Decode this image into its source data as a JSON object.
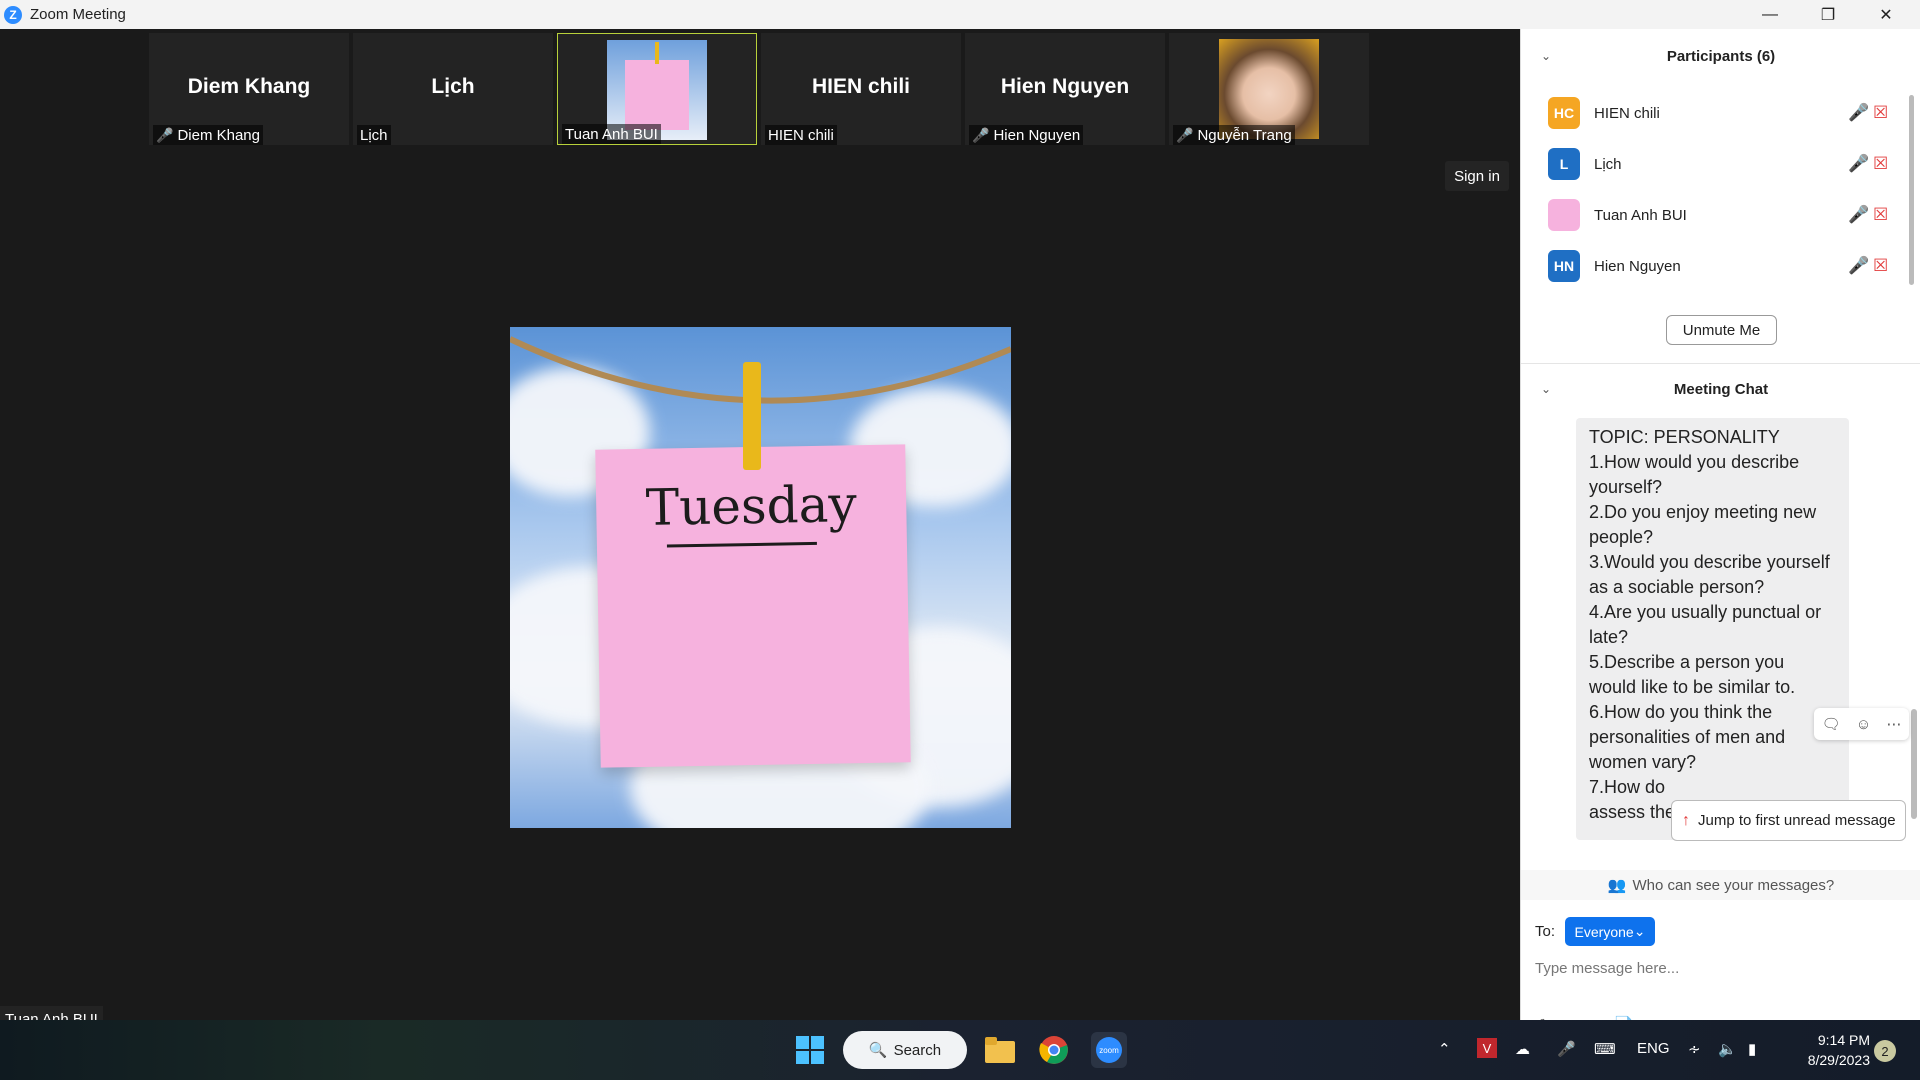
{
  "window": {
    "title": "Zoom Meeting"
  },
  "thumbnails": [
    {
      "name": "Diem Khang",
      "label": "Diem Khang",
      "muted": true
    },
    {
      "name": "Lịch",
      "label": "Lịch",
      "muted": false
    },
    {
      "name": "",
      "label": "Tuan Anh BUI",
      "muted": false
    },
    {
      "name": "HIEN chili",
      "label": "HIEN chili",
      "muted": false
    },
    {
      "name": "Hien Nguyen",
      "label": "Hien Nguyen",
      "muted": true
    },
    {
      "name": "",
      "label": "Nguyễn Trang",
      "muted": true
    }
  ],
  "sign_in": "Sign in",
  "shared_image_text": "Tuesday",
  "active_speaker": "Tuan Anh BUI",
  "participants": {
    "title": "Participants (6)",
    "list": [
      {
        "initials": "HC",
        "name": "HIEN chili",
        "color": "#f5a623",
        "mic_muted": false
      },
      {
        "initials": "L",
        "name": "Lịch",
        "color": "#1f6fc4",
        "mic_muted": false
      },
      {
        "initials": "",
        "name": "Tuan Anh BUI",
        "color": "#f6b2de",
        "mic_muted": false
      },
      {
        "initials": "HN",
        "name": "Hien Nguyen",
        "color": "#1f6fc4",
        "mic_muted": true
      }
    ],
    "unmute_label": "Unmute Me"
  },
  "chat": {
    "title": "Meeting Chat",
    "message_lines": [
      "TOPIC: PERSONALITY",
      "1.How would you describe yourself?",
      "2.Do you enjoy meeting new people?",
      "3.Would you describe yourself as a sociable person?",
      "4.Are you usually punctual or late?",
      "5.Describe a person you would like to be similar to.",
      "6.How do you think the personalities of men and women vary?",
      "7.How do",
      "assess the"
    ],
    "jump_label": "Jump to first unread message",
    "who_can_see": "Who can see your messages?",
    "to_label": "To:",
    "recipient": "Everyone",
    "input_placeholder": "Type message here..."
  },
  "taskbar": {
    "search_label": "Search",
    "language": "ENG",
    "time": "9:14 PM",
    "date": "8/29/2023",
    "notifications": "2"
  },
  "colors": {
    "accent": "#0e72ed",
    "danger": "#e23b3b",
    "highlight": "#b8d13a"
  }
}
